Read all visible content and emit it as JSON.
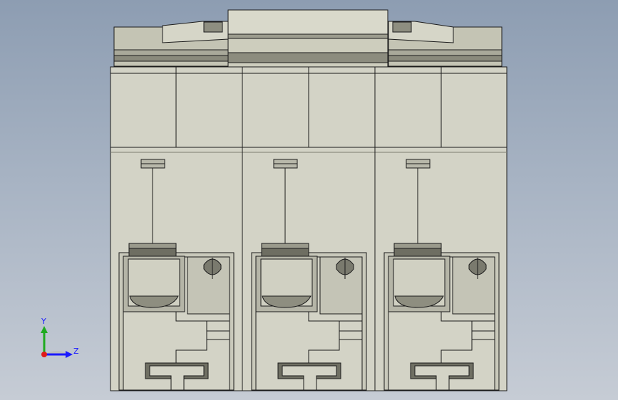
{
  "viewport": {
    "background_top": "#8d9db2",
    "background_bottom": "#c6ccd5",
    "body_color": "#d3d3c6",
    "body_shadow": "#a9a99a",
    "edge_color": "#1b1b1b",
    "top_part_color": "#c6c6b6",
    "pole_count": 3
  },
  "triad": {
    "y_label": "Y",
    "z_label": "Z",
    "y_color": "#1faa1f",
    "z_color": "#1a1aff",
    "x_color": "#e01a1a"
  }
}
